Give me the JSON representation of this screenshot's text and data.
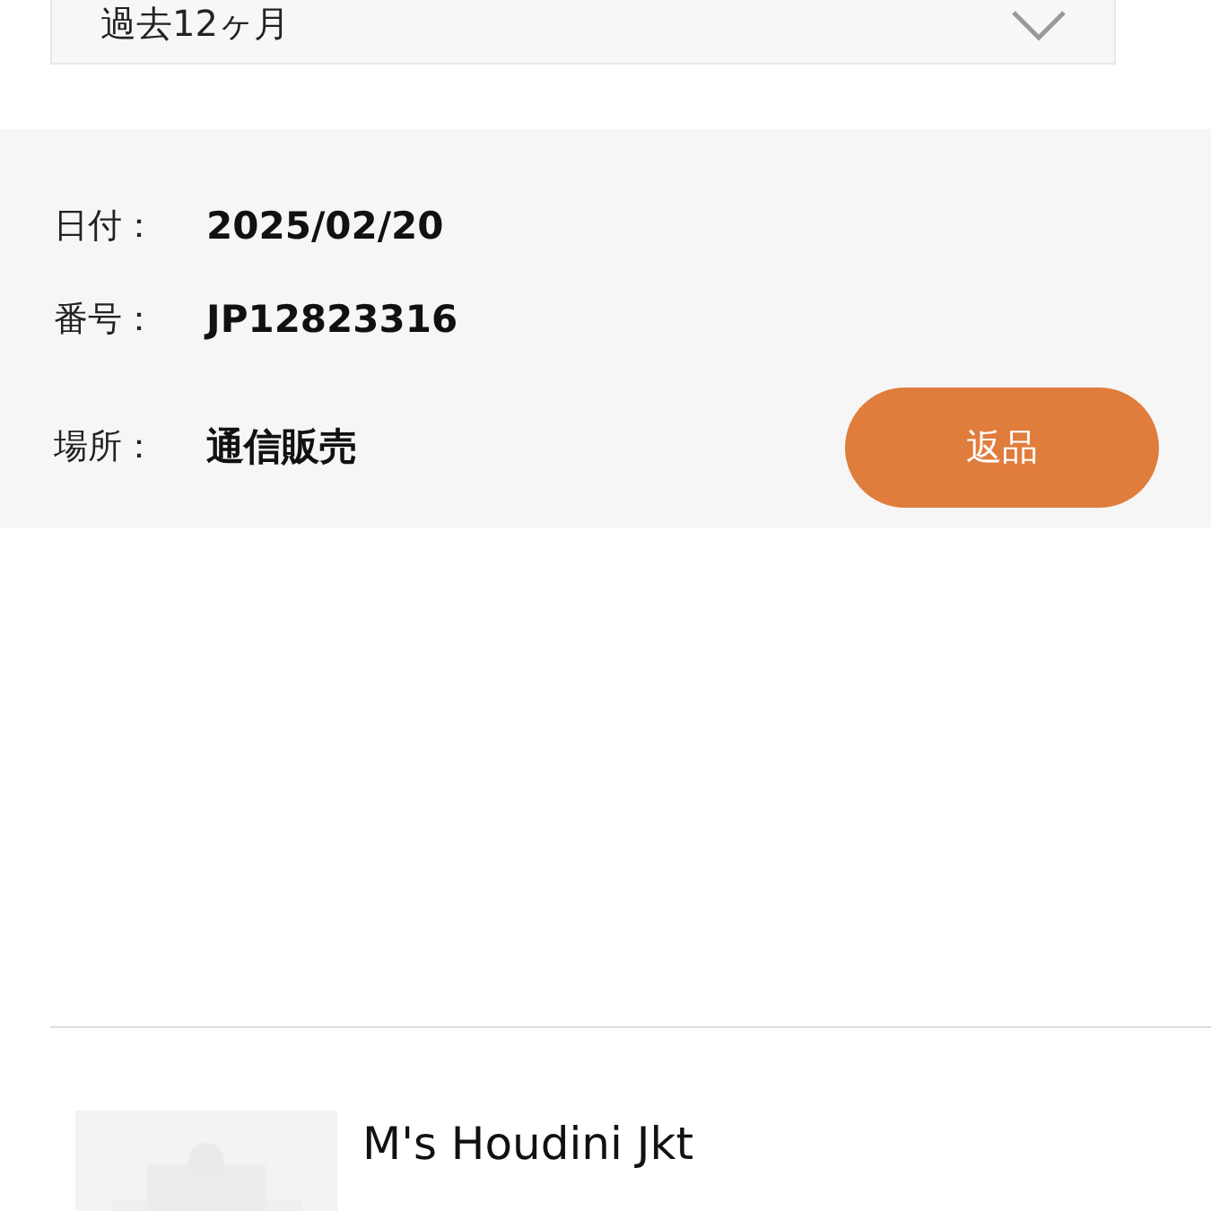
{
  "period_select": {
    "value": "過去12ヶ月"
  },
  "order": {
    "fields": [
      {
        "label": "日付：",
        "value": "2025/02/20"
      },
      {
        "label": "番号：",
        "value": "JP12823316"
      },
      {
        "label": "場所：",
        "value": "通信販売"
      }
    ],
    "return_button": "返品"
  },
  "items": [
    {
      "name": "M's Houdini Jkt"
    }
  ]
}
